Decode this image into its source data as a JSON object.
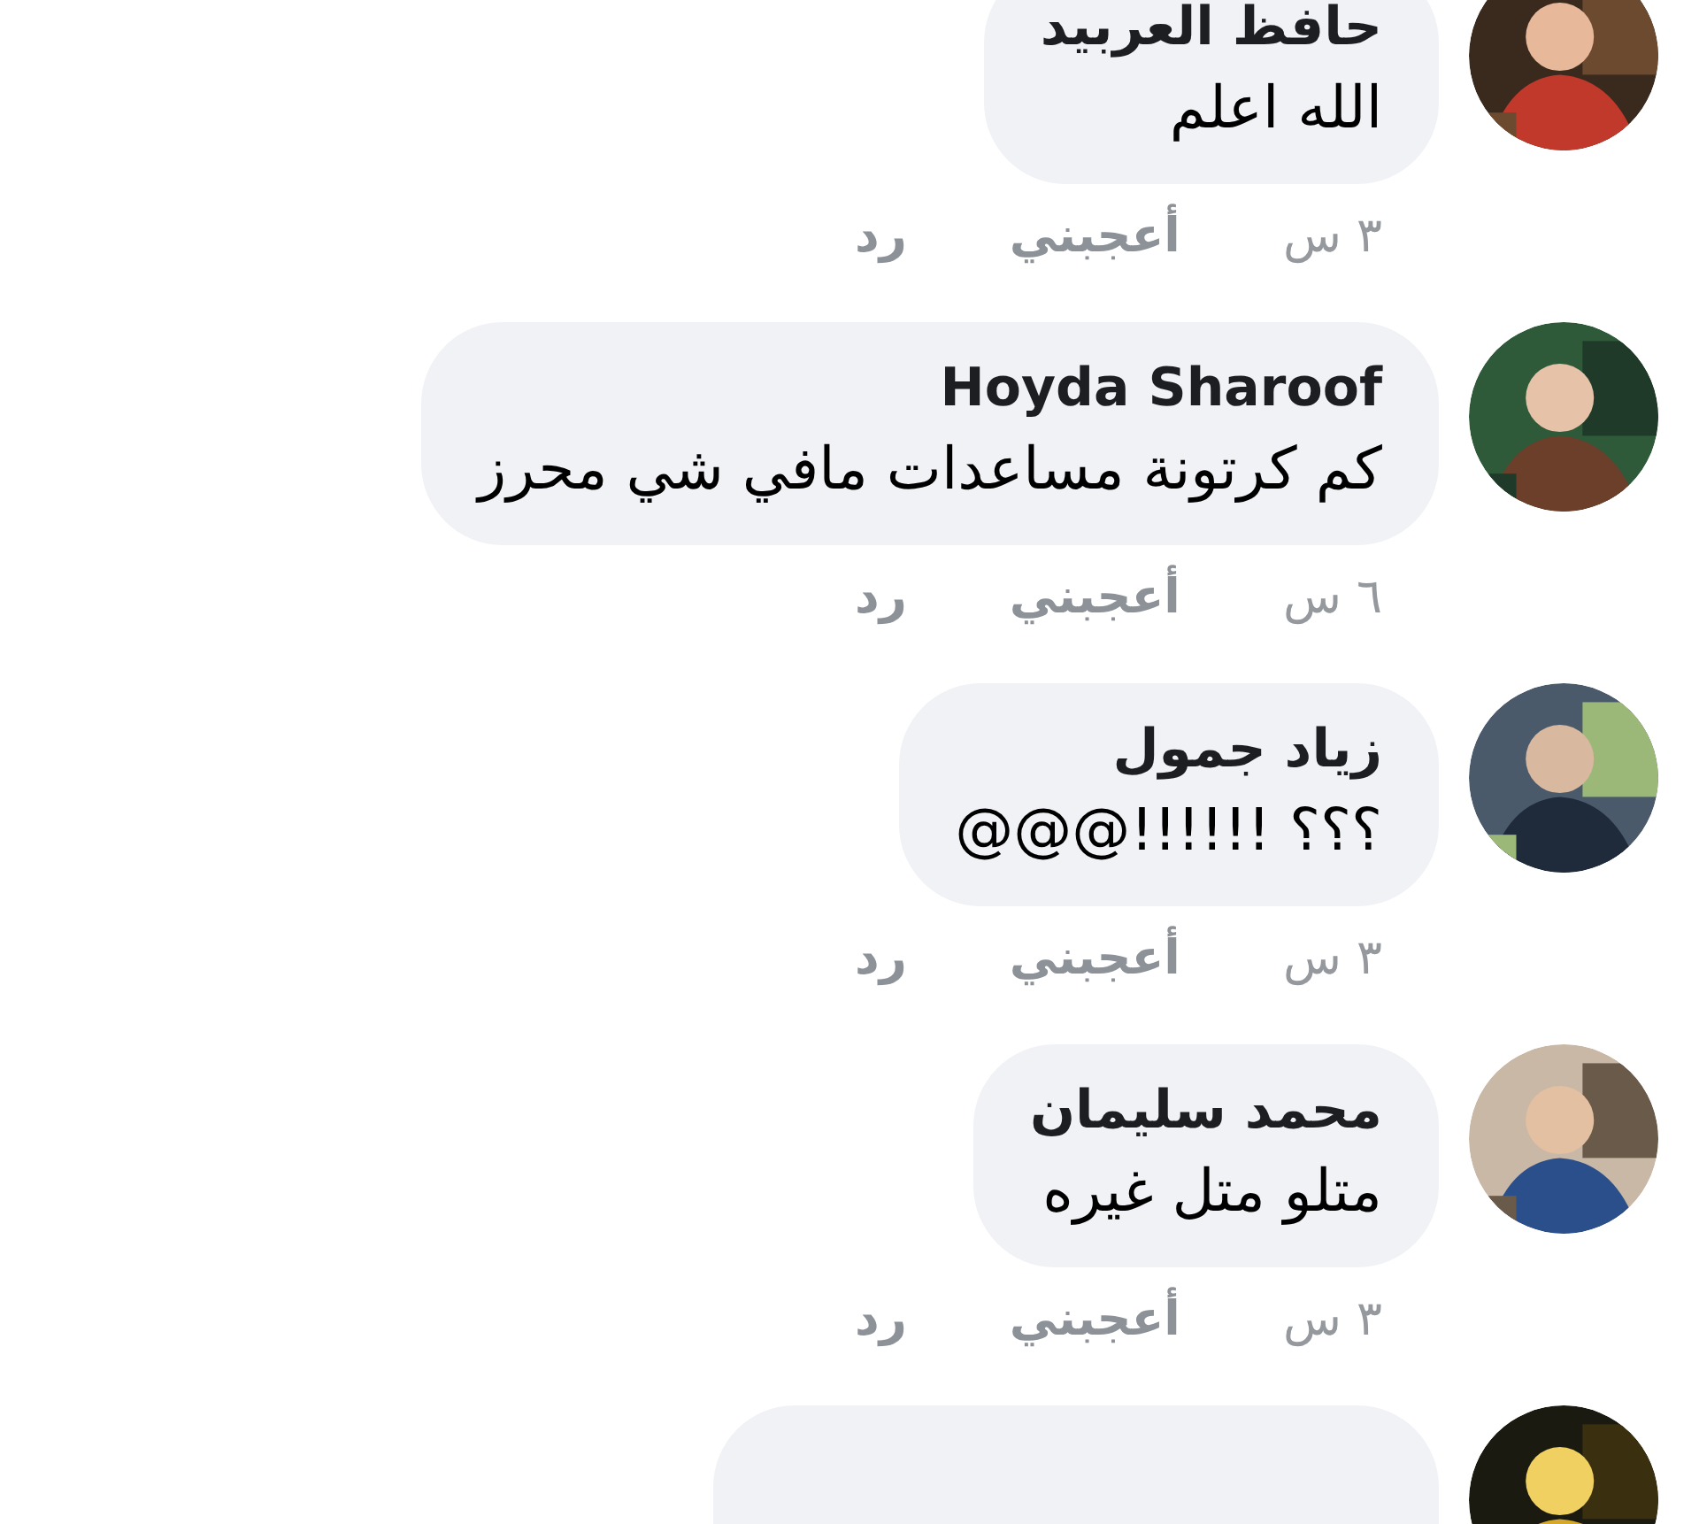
{
  "comments": [
    {
      "kind": "comment",
      "author": "حافظ العربيد",
      "text": "الله اعلم",
      "time": "٣ س",
      "like": "أعجبني",
      "reply": "رد"
    },
    {
      "kind": "comment",
      "author": "Hoyda Sharoof",
      "text": "كم كرتونة مساعدات مافي شي محرز",
      "time": "٦ س",
      "like": "أعجبني",
      "reply": "رد"
    },
    {
      "kind": "comment",
      "author": "زياد جمول",
      "text": "؟؟؟ !!!!!!@@@",
      "time": "٣ س",
      "like": "أعجبني",
      "reply": "رد"
    },
    {
      "kind": "comment",
      "author": "محمد سليمان",
      "text": "متلو متل غيره",
      "time": "٣ س",
      "like": "أعجبني",
      "reply": "رد"
    },
    {
      "kind": "cut"
    }
  ]
}
